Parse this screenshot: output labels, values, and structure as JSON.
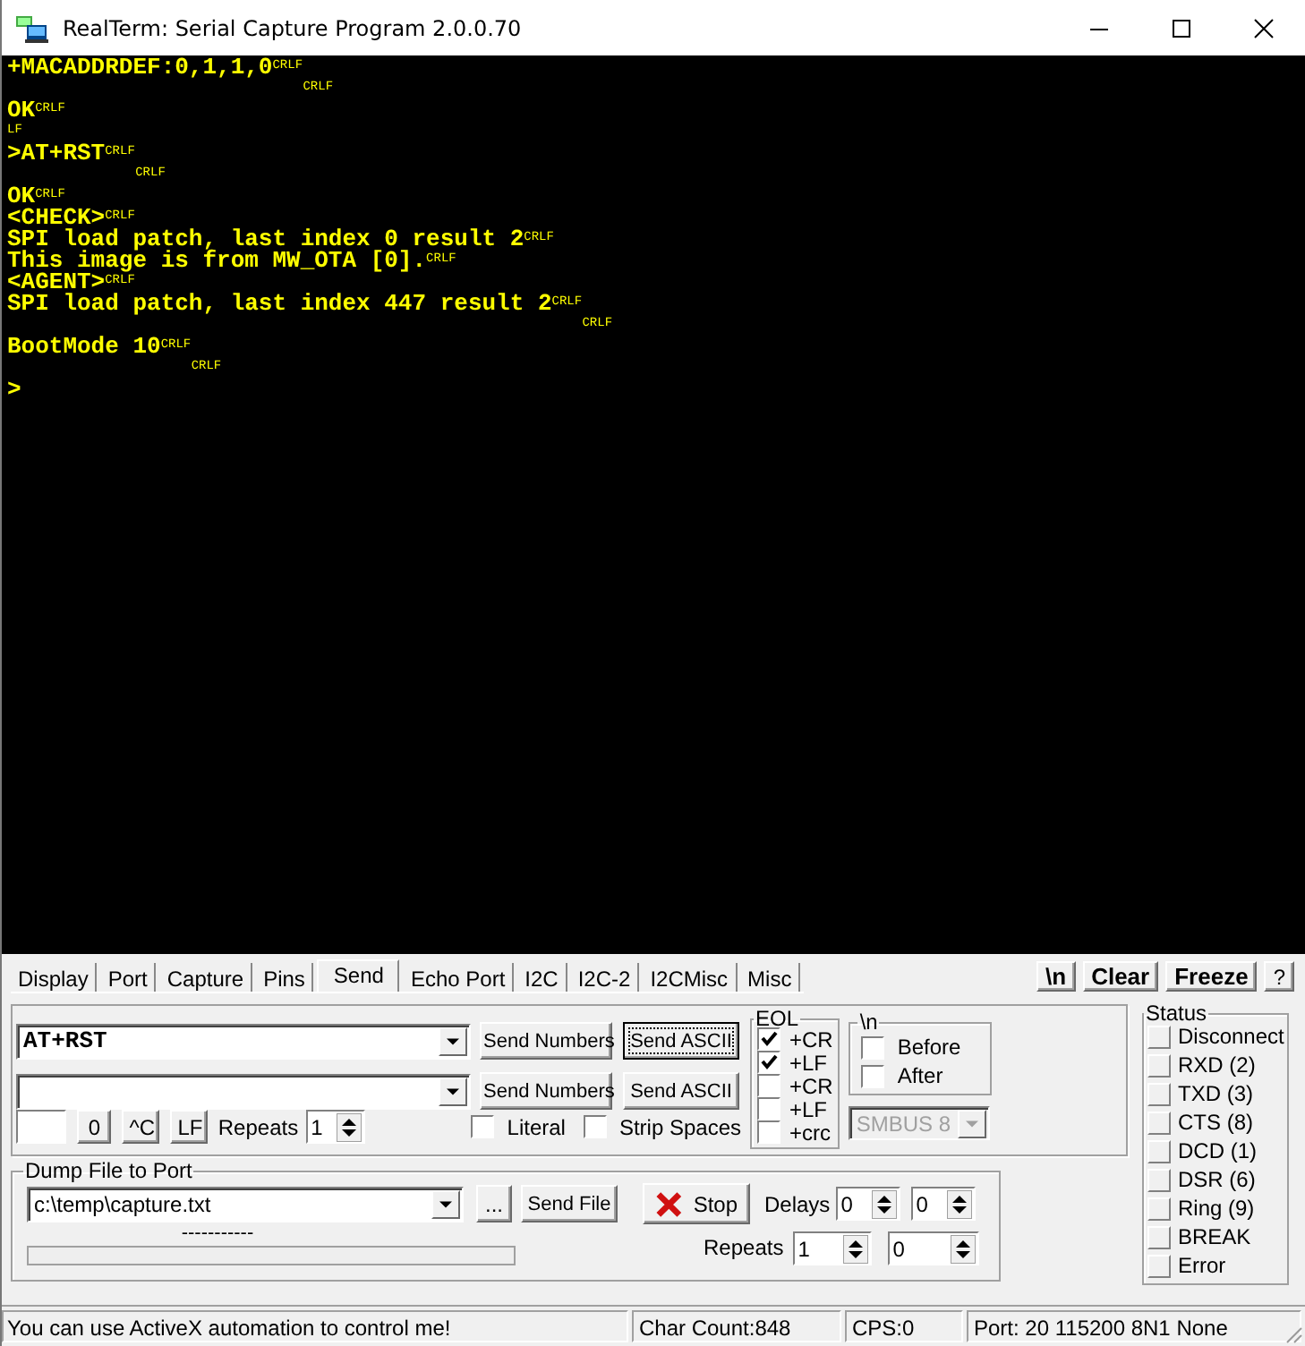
{
  "window": {
    "title": "RealTerm: Serial Capture Program 2.0.0.70"
  },
  "terminal": {
    "lines": [
      {
        "kind": "text",
        "text": "+MACADDRDEF:0,1,1,0",
        "eol": "CRLF"
      },
      {
        "kind": "continued",
        "eol": "CRLF"
      },
      {
        "kind": "text",
        "text": "OK",
        "eol": "CRLF"
      },
      {
        "kind": "text",
        "eol": "LF"
      },
      {
        "kind": "text",
        "text": ">AT+RST",
        "eol": "CRLF"
      },
      {
        "kind": "continued",
        "eol": "CRLF"
      },
      {
        "kind": "text",
        "text": "OK",
        "eol": "CRLF"
      },
      {
        "kind": "text",
        "text": "<CHECK>",
        "eol": "CRLF"
      },
      {
        "kind": "text",
        "text": "SPI load patch, last index 0 result 2",
        "eol": "CRLF"
      },
      {
        "kind": "text",
        "text": "This image is from MW_OTA [0].",
        "eol": "CRLF"
      },
      {
        "kind": "text",
        "text": "<AGENT>",
        "eol": "CRLF"
      },
      {
        "kind": "text",
        "text": "SPI load patch, last index 447 result 2",
        "eol": "CRLF"
      },
      {
        "kind": "continued",
        "eol": "CRLF"
      },
      {
        "kind": "text",
        "text": "BootMode 10",
        "eol": "CRLF"
      },
      {
        "kind": "continued",
        "eol": "CRLF"
      },
      {
        "kind": "text",
        "text": ">"
      }
    ]
  },
  "tabs": [
    {
      "label": "Display",
      "selected": false
    },
    {
      "label": "Port",
      "selected": false
    },
    {
      "label": "Capture",
      "selected": false
    },
    {
      "label": "Pins",
      "selected": false
    },
    {
      "label": "Send",
      "selected": true
    },
    {
      "label": "Echo Port",
      "selected": false
    },
    {
      "label": "I2C",
      "selected": false
    },
    {
      "label": "I2C-2",
      "selected": false
    },
    {
      "label": "I2CMisc",
      "selected": false
    },
    {
      "label": "Misc",
      "selected": false
    }
  ],
  "toolbar_buttons": [
    {
      "label": "\\n",
      "kind": "bold"
    },
    {
      "label": "Clear",
      "kind": "bold"
    },
    {
      "label": "Freeze",
      "kind": "bold"
    },
    {
      "label": "?",
      "kind": "plain"
    }
  ],
  "send_rows": [
    {
      "value": "AT+RST",
      "buttons": [
        "Send Numbers",
        "Send ASCII"
      ]
    },
    {
      "buttons": [
        "Send Numbers",
        "Send ASCII"
      ]
    }
  ],
  "keys": [
    "0",
    "^C",
    "LF"
  ],
  "repeats": {
    "label": "Repeats",
    "value": "1"
  },
  "options": [
    {
      "label": "Literal",
      "checked": false
    },
    {
      "label": "Strip Spaces",
      "checked": false
    }
  ],
  "eol": {
    "title": "EOL",
    "items": [
      {
        "label": "+CR",
        "checked": true
      },
      {
        "label": "+LF",
        "checked": true
      },
      {
        "label": "+CR",
        "checked": false
      },
      {
        "label": "+LF",
        "checked": false
      },
      {
        "label": "+crc",
        "checked": false
      }
    ]
  },
  "newline": {
    "title": "\\n",
    "items": [
      {
        "label": "Before",
        "checked": false
      },
      {
        "label": "After",
        "checked": false
      }
    ]
  },
  "smbus": {
    "value": "SMBUS 8",
    "disabled": true
  },
  "dump": {
    "title": "Dump File to Port",
    "file": "c:\\temp\\capture.txt",
    "browse": "...",
    "send_file": "Send File",
    "stop": "Stop",
    "delays_label": "Delays",
    "delays": [
      "0",
      "0"
    ],
    "progress_text": "-----------",
    "progress": {
      "level": 0
    },
    "repeats_label": "Repeats",
    "repeats": [
      "1",
      "0"
    ]
  },
  "status": {
    "title": "Status",
    "items": [
      {
        "label": "Disconnect",
        "lit": false
      },
      {
        "label": "RXD (2)",
        "lit": false
      },
      {
        "label": "TXD (3)",
        "lit": false
      },
      {
        "label": "CTS (8)",
        "lit": false
      },
      {
        "label": "DCD (1)",
        "lit": false
      },
      {
        "label": "DSR (6)",
        "lit": false
      },
      {
        "label": "Ring (9)",
        "lit": false
      },
      {
        "label": "BREAK",
        "lit": false
      },
      {
        "label": "Error",
        "lit": false
      }
    ]
  },
  "status_bar": [
    "You can use ActiveX automation to control me!",
    "Char Count:848",
    "CPS:0",
    "Port: 20 115200 8N1 None"
  ]
}
